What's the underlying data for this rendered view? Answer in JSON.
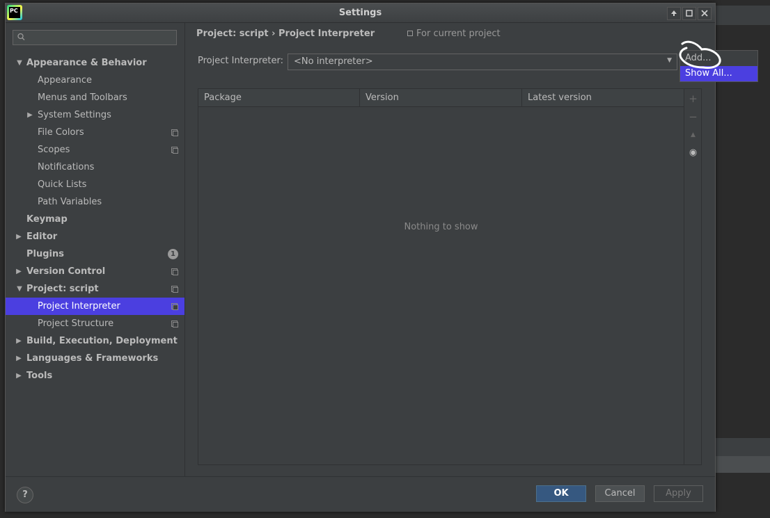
{
  "window": {
    "title": "Settings",
    "app_logo": "PC"
  },
  "search": {
    "placeholder": ""
  },
  "sidebar": {
    "items": [
      {
        "label": "Appearance & Behavior",
        "icon": "triangle-down"
      },
      {
        "label": "Appearance"
      },
      {
        "label": "Menus and Toolbars"
      },
      {
        "label": "System Settings",
        "icon": "triangle-right"
      },
      {
        "label": "File Colors",
        "icon": "copy-icon"
      },
      {
        "label": "Scopes",
        "icon": "copy-icon"
      },
      {
        "label": "Notifications"
      },
      {
        "label": "Quick Lists"
      },
      {
        "label": "Path Variables"
      },
      {
        "label": "Keymap"
      },
      {
        "label": "Editor",
        "icon": "triangle-right"
      },
      {
        "label": "Plugins",
        "badge": "1"
      },
      {
        "label": "Version Control",
        "icon": "triangle-right"
      },
      {
        "label": "Project: script",
        "icon": "triangle-down"
      },
      {
        "label": "Project Interpreter",
        "selected": true
      },
      {
        "label": "Project Structure"
      },
      {
        "label": "Build, Execution, Deployment",
        "icon": "triangle-right"
      },
      {
        "label": "Languages & Frameworks",
        "icon": "triangle-right"
      },
      {
        "label": "Tools",
        "icon": "triangle-right"
      }
    ]
  },
  "content": {
    "breadcrumb": "Project: script  ›  Project Interpreter",
    "scope": "For current project",
    "interpreter_label": "Project Interpreter:",
    "interpreter_value": "<No interpreter>",
    "table": {
      "columns": [
        "Package",
        "Version",
        "Latest version"
      ],
      "empty_text": "Nothing to show"
    },
    "tools": {
      "add": "+",
      "remove": "−",
      "upgrade": "▲",
      "show": "◉"
    }
  },
  "popup": {
    "items": [
      "Add...",
      "Show All..."
    ]
  },
  "footer": {
    "help": "?",
    "ok": "OK",
    "cancel": "Cancel",
    "apply": "Apply"
  },
  "colors": {
    "selection": "#4b3fe0",
    "ok_button": "#365880",
    "background": "#3c3f41"
  }
}
